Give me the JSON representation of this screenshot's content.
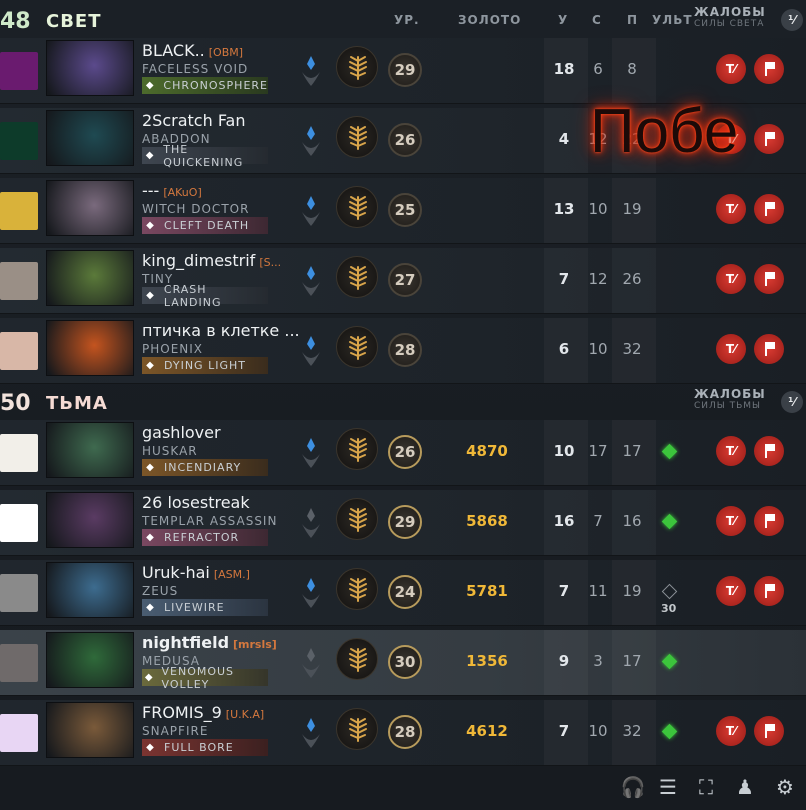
{
  "radiant": {
    "score": "48",
    "name": "СВЕТ",
    "columns": {
      "level": "УР.",
      "gold": "ЗОЛОТО",
      "kills": "У",
      "deaths": "С",
      "assists": "П",
      "ult": "УЛЬТ"
    },
    "reports_title": "ЖАЛОБЫ",
    "reports_sub": "СИЛЫ СВЕТА",
    "toggle": "⅟",
    "players": [
      {
        "name": "BLACK..",
        "tag": "[OBM]",
        "hero": "FACELESS VOID",
        "ability": "CHRONOSPHERE",
        "level": "29",
        "gold": "",
        "kills": "18",
        "deaths": "6",
        "assists": "8",
        "avatar_color": "#6a1b6f",
        "portrait_color": "#5b4a8c",
        "ability_style": "green"
      },
      {
        "name": "2Scratch Fan",
        "tag": "",
        "hero": "ABADDON",
        "ability": "THE QUICKENING",
        "level": "26",
        "gold": "",
        "kills": "4",
        "deaths": "12",
        "assists": "22",
        "avatar_color": "#0d3b2a",
        "portrait_color": "#1f4a52",
        "ability_style": "gray"
      },
      {
        "name": "---",
        "tag": "[AKuO]",
        "hero": "WITCH DOCTOR",
        "ability": "CLEFT DEATH",
        "level": "25",
        "gold": "",
        "kills": "13",
        "deaths": "10",
        "assists": "19",
        "avatar_color": "#d9b23a",
        "portrait_color": "#7a6a7d",
        "ability_style": "pink"
      },
      {
        "name": "king_dimestrif",
        "tag": "[S...",
        "hero": "TINY",
        "ability": "CRASH LANDING",
        "level": "27",
        "gold": "",
        "kills": "7",
        "deaths": "12",
        "assists": "26",
        "avatar_color": "#9a8f86",
        "portrait_color": "#5b7a3a",
        "ability_style": "gray"
      },
      {
        "name": "птичка в клетке ...",
        "tag": "",
        "hero": "PHOENIX",
        "ability": "DYING LIGHT",
        "level": "28",
        "gold": "",
        "kills": "6",
        "deaths": "10",
        "assists": "32",
        "avatar_color": "#d8b7a7",
        "portrait_color": "#c4541f",
        "ability_style": "orange"
      }
    ]
  },
  "dire": {
    "score": "50",
    "name": "ТЬМА",
    "reports_title": "ЖАЛОБЫ",
    "reports_sub": "СИЛЫ ТЬМЫ",
    "toggle": "⅟",
    "players": [
      {
        "name": "gashlover",
        "tag": "",
        "hero": "HUSKAR",
        "ability": "INCENDIARY",
        "level": "26",
        "gold": "4870",
        "kills": "10",
        "deaths": "17",
        "assists": "17",
        "ult": "ready",
        "avatar_color": "#f2efe9",
        "portrait_color": "#3f6a4f",
        "ability_style": "orange"
      },
      {
        "name": "26 losestreak",
        "tag": "",
        "hero": "TEMPLAR ASSASSIN",
        "ability": "REFRACTOR",
        "level": "29",
        "gold": "5868",
        "kills": "16",
        "deaths": "7",
        "assists": "16",
        "ult": "ready",
        "avatar_color": "#ffffff",
        "portrait_color": "#5a3b63",
        "ability_style": "pink"
      },
      {
        "name": "Uruk-hai",
        "tag": "[ASM.]",
        "hero": "ZEUS",
        "ability": "LIVEWIRE",
        "level": "24",
        "gold": "5781",
        "kills": "7",
        "deaths": "11",
        "assists": "19",
        "ult": "cooldown",
        "ult_cd": "30",
        "avatar_color": "#8a8a8a",
        "portrait_color": "#3d6c8f",
        "ability_style": "blue"
      },
      {
        "name": "nightfield",
        "tag": "[mrsls]",
        "hero": "MEDUSA",
        "ability": "VENOMOUS VOLLEY",
        "level": "30",
        "gold": "1356",
        "kills": "9",
        "deaths": "3",
        "assists": "17",
        "ult": "ready",
        "avatar_color": "#6f6a6a",
        "portrait_color": "#2f6a3a",
        "ability_style": "olive"
      },
      {
        "name": "FROMIS_9",
        "tag": "[U.K.A]",
        "hero": "SNAPFIRE",
        "ability": "FULL BORE",
        "level": "28",
        "gold": "4612",
        "kills": "7",
        "deaths": "10",
        "assists": "32",
        "ult": "ready",
        "avatar_color": "#e8d6f4",
        "portrait_color": "#7a5a3a",
        "ability_style": "red"
      }
    ]
  },
  "overlay": {
    "victory_text": "Побе"
  },
  "mute_label": "T⁄",
  "bottom_icons": [
    "headset-icon",
    "scoreboard-icon",
    "shared-units-icon",
    "coach-icon",
    "settings-icon"
  ]
}
